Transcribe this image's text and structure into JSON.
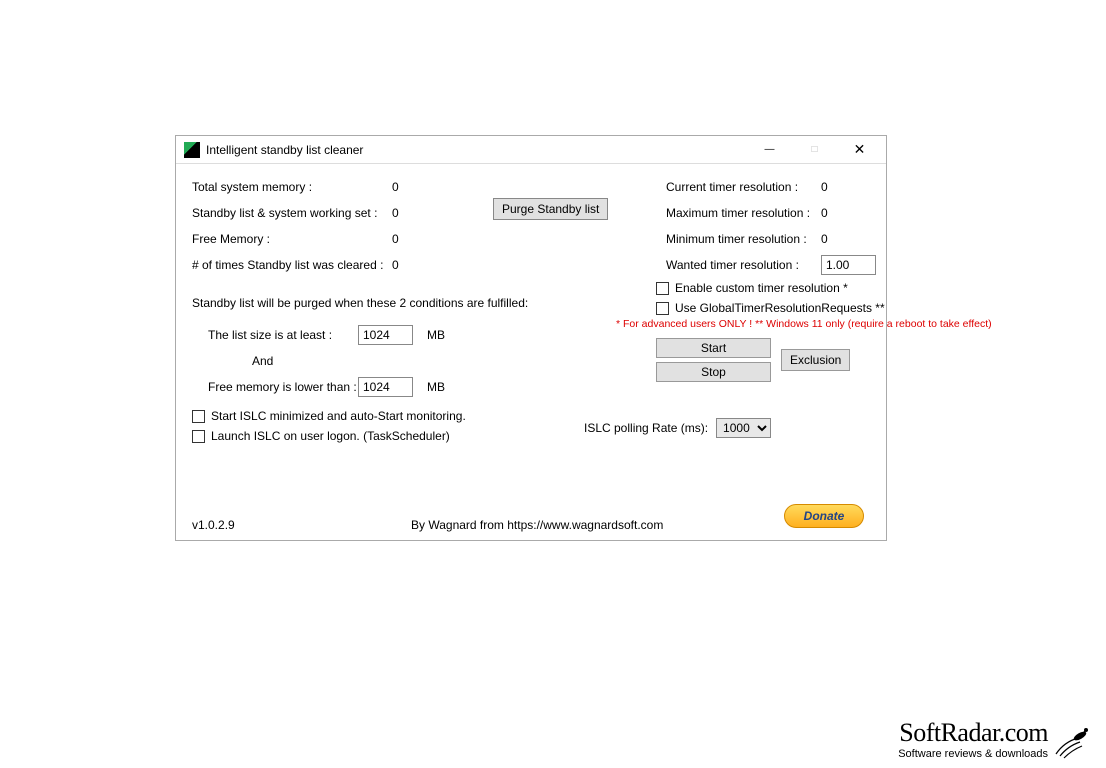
{
  "window": {
    "title": "Intelligent standby list cleaner"
  },
  "left": {
    "total_memory_label": "Total system memory :",
    "total_memory_value": "0",
    "standby_set_label": "Standby list & system working set :",
    "standby_set_value": "0",
    "free_memory_label": "Free Memory :",
    "free_memory_value": "0",
    "cleared_count_label": "# of times Standby list was cleared :",
    "cleared_count_value": "0",
    "purge_label": "Purge Standby list",
    "conditions_text": "Standby list will be purged when these 2 conditions are fulfilled:",
    "list_size_label": "The list size is at least :",
    "list_size_value": "1024",
    "list_size_unit": "MB",
    "and_label": "And",
    "free_lower_label": "Free memory is lower than :",
    "free_lower_value": "1024",
    "free_lower_unit": "MB",
    "chk_minimized": "Start ISLC minimized and auto-Start monitoring.",
    "chk_logon": "Launch ISLC on user logon. (TaskScheduler)"
  },
  "right": {
    "cur_timer_label": "Current timer resolution :",
    "cur_timer_value": "0",
    "max_timer_label": "Maximum timer resolution :",
    "max_timer_value": "0",
    "min_timer_label": "Minimum timer resolution :",
    "min_timer_value": "0",
    "wanted_timer_label": "Wanted timer resolution :",
    "wanted_timer_value": "1.00",
    "chk_custom_timer": "Enable custom timer resolution *",
    "chk_global_timer": "Use GlobalTimerResolutionRequests **",
    "warning": "* For advanced users ONLY !  ** Windows 11 only (require a reboot to take effect)",
    "start_label": "Start",
    "stop_label": "Stop",
    "exclusion_label": "Exclusion",
    "polling_label": "ISLC polling Rate (ms):",
    "polling_value": "1000"
  },
  "footer": {
    "version": "v1.0.2.9",
    "byline": "By Wagnard from https://www.wagnardsoft.com",
    "donate": "Donate"
  },
  "watermark": {
    "brand": "SoftRadar.com",
    "tag": "Software reviews & downloads"
  }
}
